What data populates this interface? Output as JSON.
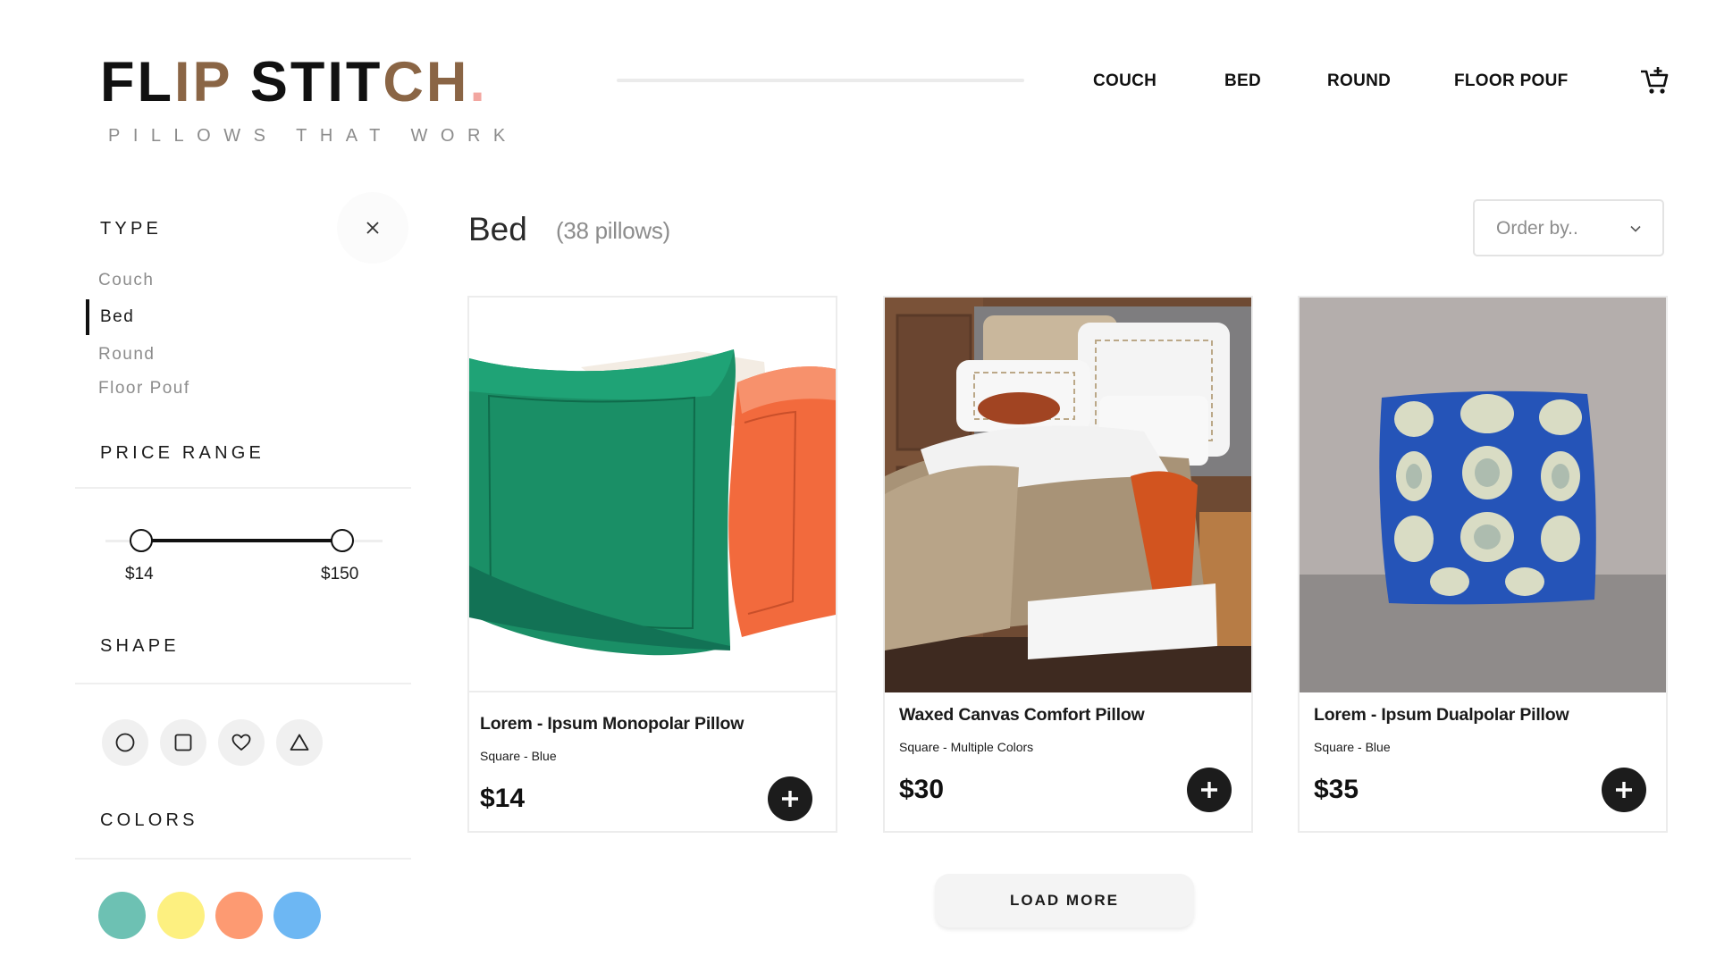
{
  "brand": {
    "title_dark_1": "FL",
    "title_brown_1": "IP ",
    "title_dark_2": "STIT",
    "title_brown_2": "CH",
    "title_dot": ".",
    "tagline": "PILLOWS THAT WORK"
  },
  "nav": {
    "items": [
      {
        "label": "COUCH"
      },
      {
        "label": "BED"
      },
      {
        "label": "ROUND"
      },
      {
        "label": "FLOOR POUF"
      }
    ],
    "cart_icon": "cart-add-icon"
  },
  "sidebar": {
    "type": {
      "heading": "TYPE",
      "close_icon": "close-icon",
      "items": [
        {
          "label": "Couch",
          "active": false
        },
        {
          "label": "Bed",
          "active": true
        },
        {
          "label": "Round",
          "active": false
        },
        {
          "label": "Floor Pouf",
          "active": false
        }
      ]
    },
    "price_range": {
      "heading": "PRICE RANGE",
      "min_label": "$14",
      "max_label": "$150"
    },
    "shape": {
      "heading": "SHAPE",
      "icons": [
        "circle-icon",
        "square-icon",
        "heart-icon",
        "triangle-icon"
      ]
    },
    "colors": {
      "heading": "COLORS",
      "swatches": [
        "#6dc1b3",
        "#fdf080",
        "#fd9a72",
        "#6db7f3"
      ]
    }
  },
  "main": {
    "category_title": "Bed",
    "category_count": "(38 pillows)",
    "order_placeholder": "Order by..",
    "load_more": "LOAD MORE"
  },
  "products": [
    {
      "name": "Lorem - Ipsum Monopolar Pillow",
      "meta": "Square - Blue",
      "price": "$14"
    },
    {
      "name": "Waxed Canvas Comfort Pillow",
      "meta": "Square - Multiple Colors",
      "price": "$30"
    },
    {
      "name": "Lorem - Ipsum Dualpolar Pillow",
      "meta": "Square - Blue",
      "price": "$35"
    }
  ],
  "colors": {
    "brand_brown": "#8a6545",
    "brand_pink": "#f2a6a0",
    "text_dark": "#1a1a1a",
    "text_muted": "#8c8c8c"
  }
}
